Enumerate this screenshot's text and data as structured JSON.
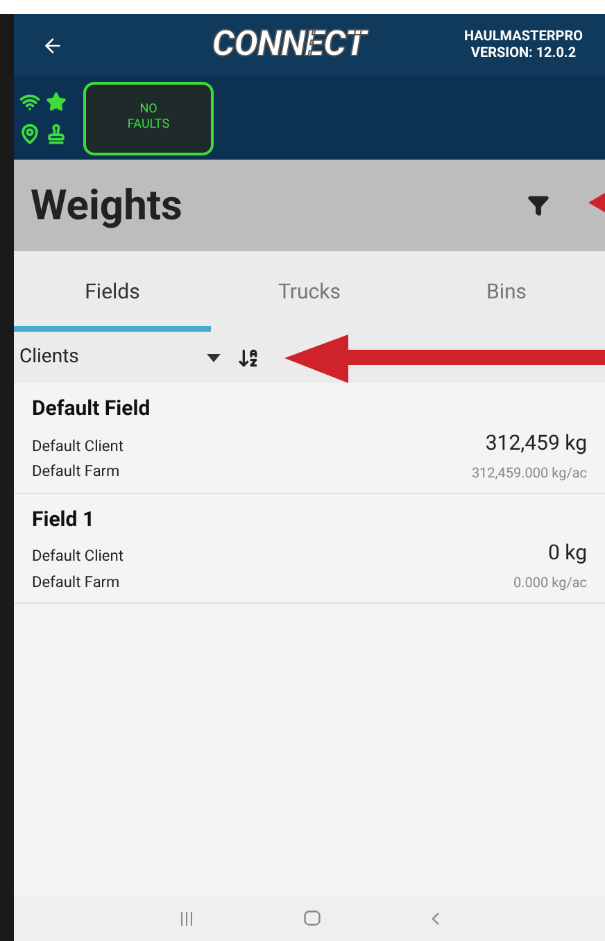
{
  "header": {
    "logo": "CONNECT",
    "app_name": "HAULMASTERPRO",
    "version": "VERSION: 12.0.2"
  },
  "status": {
    "faults": "NO\nFAULTS"
  },
  "page": {
    "title": "Weights"
  },
  "tabs": [
    {
      "label": "Fields",
      "selected": true
    },
    {
      "label": "Trucks",
      "selected": false
    },
    {
      "label": "Bins",
      "selected": false
    }
  ],
  "filter": {
    "value": "Clients"
  },
  "rows": [
    {
      "name": "Default Field",
      "client": "Default Client",
      "farm": "Default Farm",
      "weight": "312,459 kg",
      "rate": "312,459.000 kg/ac"
    },
    {
      "name": "Field 1",
      "client": "Default Client",
      "farm": "Default Farm",
      "weight": "0 kg",
      "rate": "0.000 kg/ac"
    }
  ]
}
